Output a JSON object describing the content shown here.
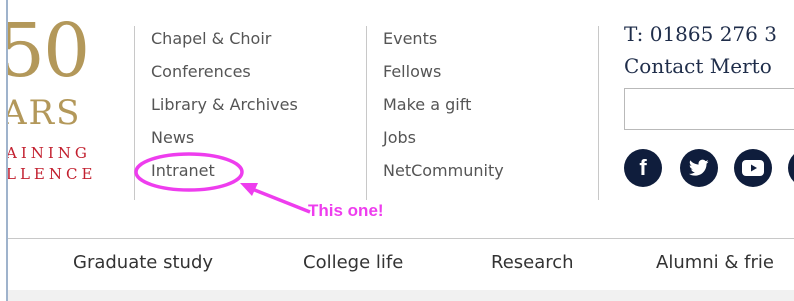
{
  "logo": {
    "number": "50",
    "years": "ARS",
    "tagline_1": "AINING",
    "tagline_2": "LLENCE"
  },
  "header_links": {
    "column_1": [
      "Chapel & Choir",
      "Conferences",
      "Library & Archives",
      "News",
      "Intranet"
    ],
    "column_2": [
      "Events",
      "Fellows",
      "Make a gift",
      "Jobs",
      "NetCommunity"
    ]
  },
  "contact": {
    "phone": "T: 01865 276 3",
    "link": "Contact Merto"
  },
  "social": [
    "facebook-icon",
    "twitter-icon",
    "youtube-icon",
    "instagram-icon"
  ],
  "annotation": {
    "text": "This one!",
    "color": "#ee3dee"
  },
  "main_nav": [
    "Graduate study",
    "College life",
    "Research",
    "Alumni & frie"
  ],
  "colors": {
    "gold": "#b3985a",
    "red": "#c21f2e",
    "navy": "#0f1d3c",
    "annotation": "#ee3dee"
  }
}
